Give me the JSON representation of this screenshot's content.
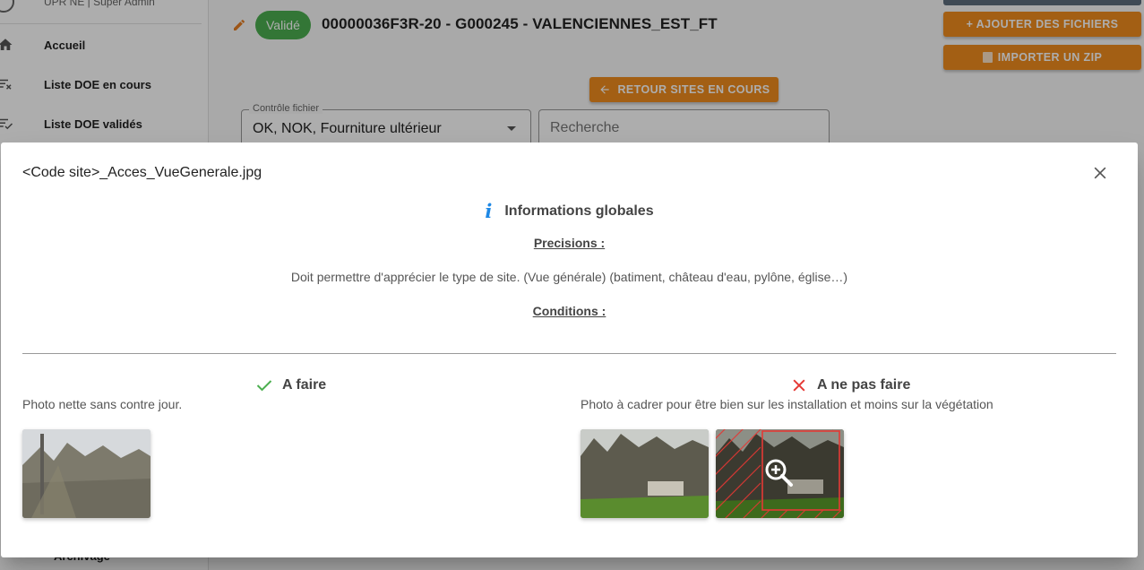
{
  "sidebar": {
    "user_label": "UPR NE | Super Admin",
    "items": [
      {
        "label": "Accueil",
        "icon": "home-icon"
      },
      {
        "label": "Liste DOE en cours",
        "icon": "filter-list-x-icon"
      },
      {
        "label": "Liste DOE validés",
        "icon": "list-check-icon"
      }
    ],
    "bottom_item": "Archivage"
  },
  "header": {
    "status_badge": "Validé",
    "site_title": "00000036F3R-20 - G000245 - VALENCIENNES_EST_FT",
    "btn_ajouter": "+ AJOUTER DES FICHIERS",
    "btn_importer": "IMPORTER UN ZIP",
    "btn_retour": "RETOUR SITES EN COURS"
  },
  "filters": {
    "controle_label": "Contrôle fichier",
    "controle_value": "OK, NOK, Fourniture ultérieur",
    "search_placeholder": "Recherche"
  },
  "modal": {
    "title": "<Code site>_Acces_VueGenerale.jpg",
    "info_title": "Informations globales",
    "precisions_label": "Precisions :",
    "precisions_text": "Doit permettre d'apprécier le type de site. (Vue générale) (batiment, château d'eau, pylône, église…)",
    "conditions_label": "Conditions :",
    "do": {
      "label": "A faire",
      "description": "Photo nette sans contre jour."
    },
    "dont": {
      "label": "A ne pas faire",
      "description": "Photo à cadrer pour être bien sur les installation et moins sur la végétation"
    }
  },
  "colors": {
    "accent_orange": "#f08c1e",
    "valid_green": "#4caf50",
    "info_blue": "#1e88e5",
    "error_red": "#e53935"
  }
}
